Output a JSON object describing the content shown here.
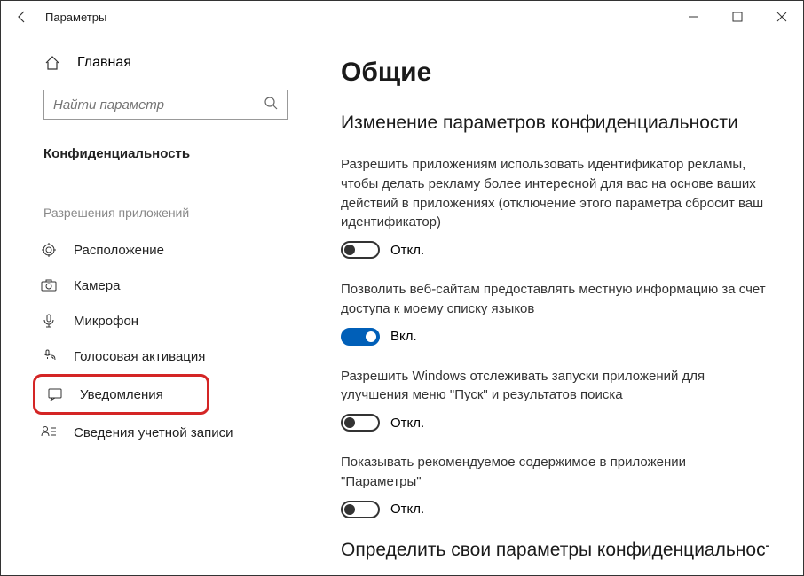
{
  "window": {
    "title": "Параметры"
  },
  "sidebar": {
    "home_label": "Главная",
    "search_placeholder": "Найти параметр",
    "section_label": "Конфиденциальность",
    "subsection_label": "Разрешения приложений",
    "items": [
      {
        "label": "Расположение"
      },
      {
        "label": "Камера"
      },
      {
        "label": "Микрофон"
      },
      {
        "label": "Голосовая активация"
      },
      {
        "label": "Уведомления"
      },
      {
        "label": "Сведения учетной записи"
      }
    ]
  },
  "content": {
    "heading": "Общие",
    "subheading": "Изменение параметров конфиденциальности",
    "settings": [
      {
        "desc": "Разрешить приложениям использовать идентификатор рекламы, чтобы делать рекламу более интересной для вас на основе ваших действий в приложениях (отключение этого параметра сбросит ваш идентификатор)",
        "state_label": "Откл.",
        "on": false
      },
      {
        "desc": "Позволить веб-сайтам предоставлять местную информацию за счет доступа к моему списку языков",
        "state_label": "Вкл.",
        "on": true
      },
      {
        "desc": "Разрешить Windows отслеживать запуски приложений для улучшения меню \"Пуск\" и результатов поиска",
        "state_label": "Откл.",
        "on": false
      },
      {
        "desc": "Показывать рекомендуемое содержимое в приложении \"Параметры\"",
        "state_label": "Откл.",
        "on": false
      }
    ],
    "cutoff_heading": "Определить свои параметры конфиденциальности"
  }
}
